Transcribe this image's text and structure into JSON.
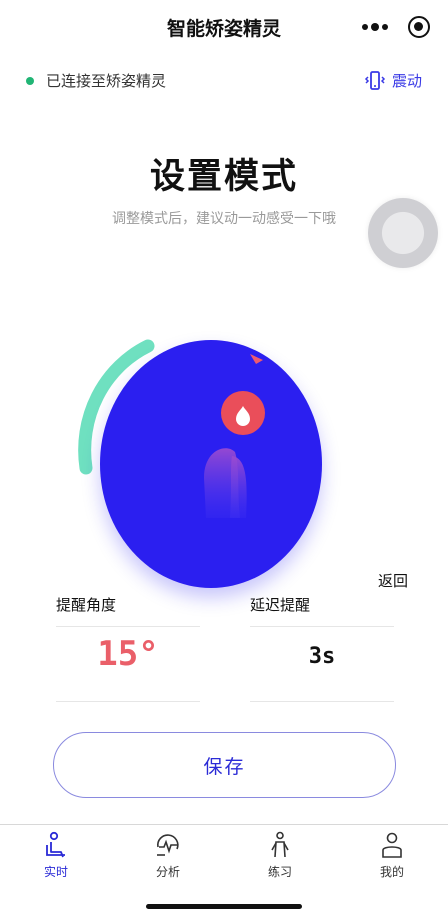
{
  "nav": {
    "title": "智能矫姿精灵"
  },
  "status": {
    "connection_text": "已连接至矫姿精灵",
    "connected_color": "#21b575",
    "vibrate_label": "震动",
    "accent": "#3a3ae6"
  },
  "main": {
    "title": "设置模式",
    "subtitle": "调整模式后，建议动一动感受一下哦",
    "back_label": "返回"
  },
  "params": [
    {
      "label": "提醒角度",
      "value": "15°"
    },
    {
      "label": "延迟提醒",
      "value": "3s"
    }
  ],
  "save_label": "保存",
  "tabs": [
    {
      "label": "实时",
      "icon": "seated-person-icon",
      "active": true
    },
    {
      "label": "分析",
      "icon": "analysis-icon",
      "active": false
    },
    {
      "label": "练习",
      "icon": "exercise-icon",
      "active": false
    },
    {
      "label": "我的",
      "icon": "profile-icon",
      "active": false
    }
  ]
}
